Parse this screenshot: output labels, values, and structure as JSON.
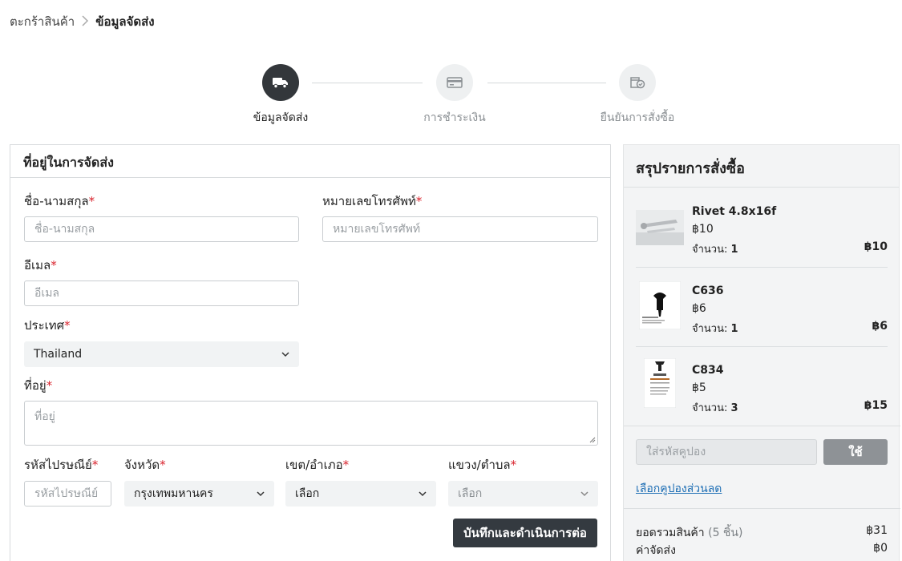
{
  "breadcrumb": {
    "parent": "ตะกร้าสินค้า",
    "separator": ">",
    "current": "ข้อมูลจัดส่ง"
  },
  "stepper": {
    "steps": [
      {
        "label": "ข้อมูลจัดส่ง",
        "icon": "truck-icon",
        "state": "active"
      },
      {
        "label": "การชำระเงิน",
        "icon": "credit-card-icon",
        "state": "inactive"
      },
      {
        "label": "ยืนยันการสั่งซื้อ",
        "icon": "order-check-icon",
        "state": "inactive"
      }
    ]
  },
  "form": {
    "title": "ที่อยู่ในการจัดส่ง",
    "required_mark": "*",
    "name_label": "ชื่อ-นามสกุล",
    "name_placeholder": "ชื่อ-นามสกุล",
    "phone_label": "หมายเลขโทรศัพท์",
    "phone_placeholder": "หมายเลขโทรศัพท์",
    "email_label": "อีเมล",
    "email_placeholder": "อีเมล",
    "country_label": "ประเทศ",
    "country_value": "Thailand",
    "address_label": "ที่อยู่",
    "address_placeholder": "ที่อยู่",
    "postcode_label": "รหัสไปรษณีย์",
    "postcode_placeholder": "รหัสไปรษณีย์",
    "province_label": "จังหวัด",
    "province_value": "กรุงเทพมหานคร",
    "district_label": "เขต/อำเภอ",
    "district_value": "เลือก",
    "subdistrict_label": "แขวง/ตำบล",
    "subdistrict_value": "เลือก",
    "save_label": "บันทึกและดำเนินการต่อ"
  },
  "summary": {
    "title": "สรุปรายการสั่งซื้อ",
    "qty_label": "จำนวน:",
    "items": [
      {
        "name": "Rivet 4.8x16f",
        "price": "฿10",
        "qty": "1",
        "total": "฿10"
      },
      {
        "name": "C636",
        "price": "฿6",
        "qty": "1",
        "total": "฿6"
      },
      {
        "name": "C834",
        "price": "฿5",
        "qty": "3",
        "total": "฿15"
      }
    ],
    "coupon_placeholder": "ใส่รหัสคูปอง",
    "coupon_button": "ใช้",
    "coupon_link": "เลือกคูปองส่วนลด",
    "subtotal_label": "ยอดรวมสินค้า",
    "subtotal_count": "(5 ชิ้น)",
    "subtotal_value": "฿31",
    "shipping_label": "ค่าจัดส่ง",
    "shipping_value": "฿0"
  },
  "colors": {
    "accent_dark": "#343a40",
    "required": "#d9232d",
    "link": "#1f6fb5"
  }
}
